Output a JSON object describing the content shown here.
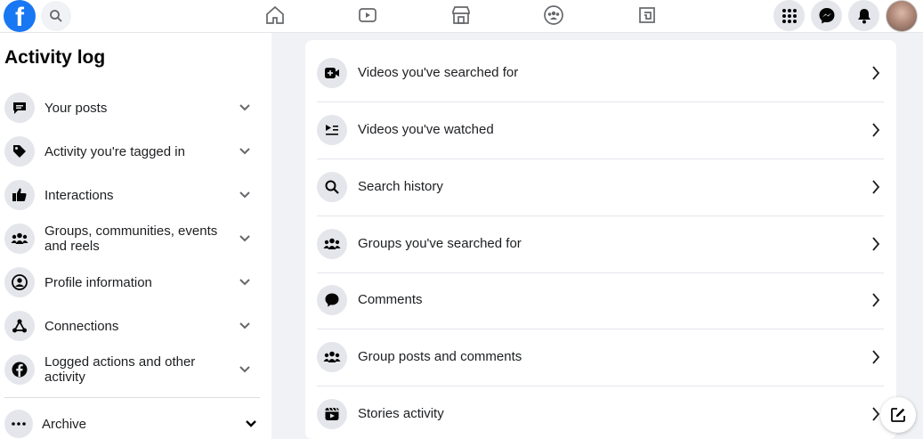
{
  "brand": {
    "logo_letter": "f",
    "accent": "#1877f2"
  },
  "topbar": {
    "nav_icons": [
      "home-icon",
      "video-icon",
      "marketplace-icon",
      "groups-icon",
      "gaming-icon"
    ],
    "right_icons": [
      "menu-grid-icon",
      "messenger-icon",
      "notifications-icon"
    ]
  },
  "sidebar": {
    "title": "Activity log",
    "items": [
      {
        "label": "Your posts",
        "icon": "post-icon"
      },
      {
        "label": "Activity you're tagged in",
        "icon": "tag-icon"
      },
      {
        "label": "Interactions",
        "icon": "like-icon"
      },
      {
        "label": "Groups, communities, events and reels",
        "icon": "people-icon"
      },
      {
        "label": "Profile information",
        "icon": "profile-icon"
      },
      {
        "label": "Connections",
        "icon": "connections-icon"
      },
      {
        "label": "Logged actions and other activity",
        "icon": "facebook-icon"
      }
    ],
    "archive": {
      "label": "Archive",
      "icon": "more-icon"
    }
  },
  "main": {
    "items": [
      {
        "label": "Videos you've searched for",
        "icon": "video-search-icon"
      },
      {
        "label": "Videos you've watched",
        "icon": "video-list-icon"
      },
      {
        "label": "Search history",
        "icon": "search-icon"
      },
      {
        "label": "Groups you've searched for",
        "icon": "group-icon"
      },
      {
        "label": "Comments",
        "icon": "comment-icon"
      },
      {
        "label": "Group posts and comments",
        "icon": "group-posts-icon"
      },
      {
        "label": "Stories activity",
        "icon": "stories-icon"
      }
    ]
  }
}
